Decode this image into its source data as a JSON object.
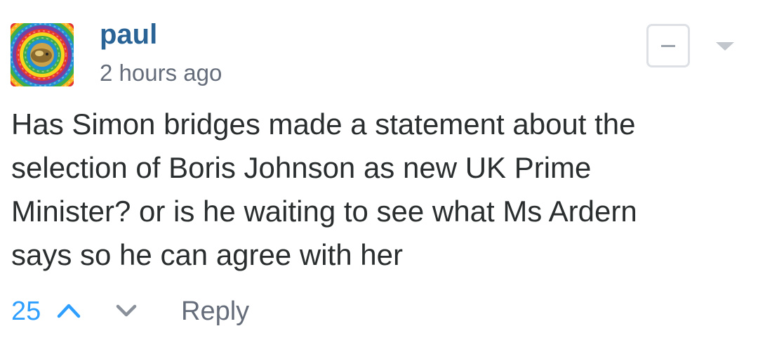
{
  "comment": {
    "author": "paul",
    "timestamp": "2 hours ago",
    "body_lines": [
      "Has Simon bridges made a statement about the",
      "selection of Boris Johnson as new UK Prime",
      "Minister? or is he waiting to see what Ms Ardern",
      "says so he can agree with her"
    ],
    "votes": "25",
    "reply_label": "Reply"
  },
  "icons": {
    "collapse": "minus-square-icon",
    "menu": "caret-down-icon",
    "upvote": "chevron-up-icon",
    "downvote": "chevron-down-icon",
    "avatar": "psychedelic-avatar"
  },
  "colors": {
    "author": "#2a6497",
    "meta": "#656c7a",
    "body": "#2a2e2e",
    "vote": "#2e9fff",
    "border": "#dde1e6"
  }
}
